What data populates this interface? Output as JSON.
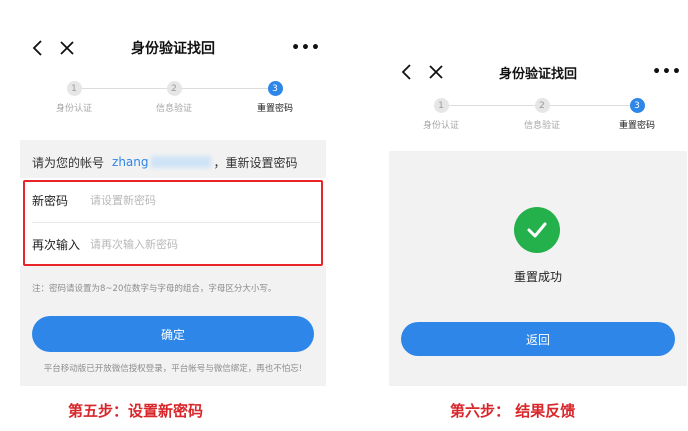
{
  "left_screen": {
    "nav": {
      "title": "身份验证找回",
      "more": "•••"
    },
    "steps": [
      {
        "num": "1",
        "label": "身份认证",
        "active": false
      },
      {
        "num": "2",
        "label": "信息验证",
        "active": false
      },
      {
        "num": "3",
        "label": "重置密码",
        "active": true
      }
    ],
    "account": {
      "prefix": "请为您的帐号",
      "username": "zhang",
      "suffix": "，重新设置密码"
    },
    "form": {
      "new_password": {
        "label": "新密码",
        "placeholder": "请设置新密码"
      },
      "confirm_password": {
        "label": "再次输入",
        "placeholder": "请再次输入新密码"
      }
    },
    "note": "注：密码请设置为8~20位数字与字母的组合，字母区分大小写。",
    "confirm_button": "确定",
    "footer_tip": "平台移动版已开放微信授权登录，平台帐号与微信绑定，再也不怕忘!"
  },
  "right_screen": {
    "nav": {
      "title": "身份验证找回",
      "more": "•••"
    },
    "steps": [
      {
        "num": "1",
        "label": "身份认证",
        "active": false
      },
      {
        "num": "2",
        "label": "信息验证",
        "active": false
      },
      {
        "num": "3",
        "label": "重置密码",
        "active": true
      }
    ],
    "success_text": "重置成功",
    "return_button": "返回"
  },
  "captions": {
    "left": "第五步：设置新密码",
    "right": "第六步： 结果反馈"
  },
  "colors": {
    "accent": "#2e86e8",
    "success": "#24b04b",
    "highlight": "#e8262a",
    "caption": "#d8262b"
  },
  "icons": [
    "back-arrow-icon",
    "close-icon",
    "more-icon",
    "checkmark-icon"
  ]
}
